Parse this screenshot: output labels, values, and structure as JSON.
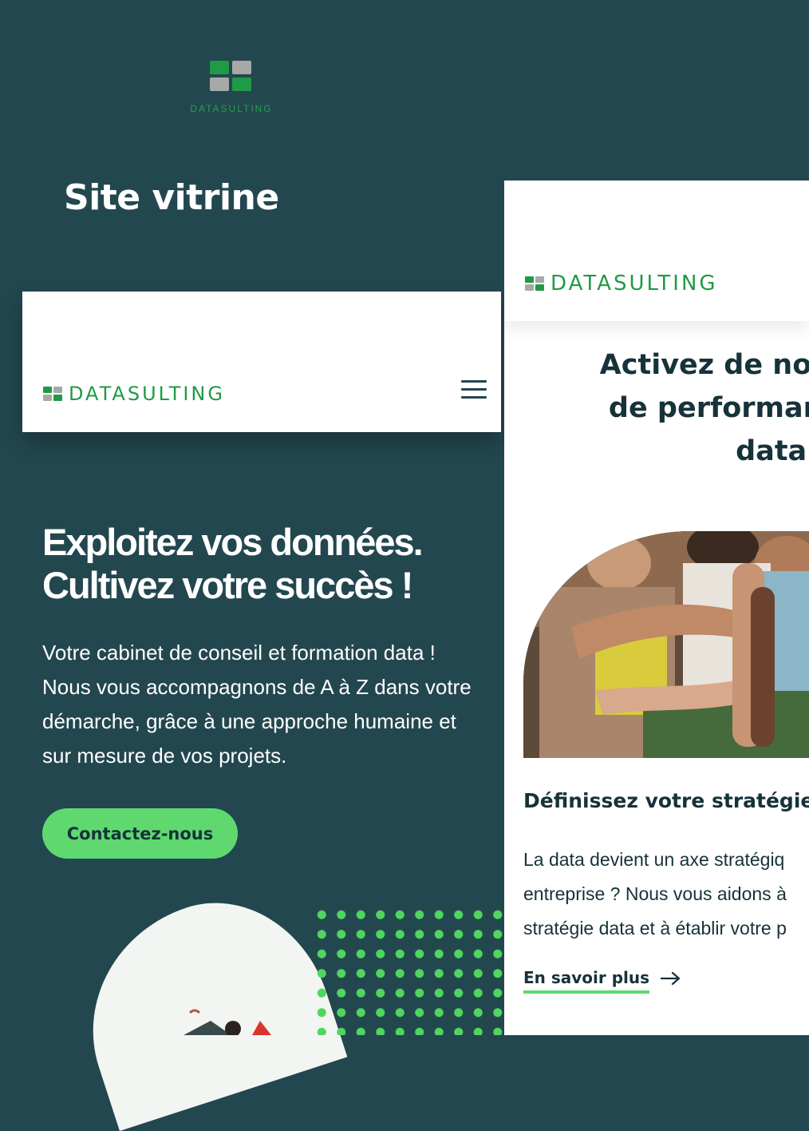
{
  "colors": {
    "background": "#23474f",
    "brand_green": "#1f9a46",
    "accent_green": "#5fd96f",
    "dark_text": "#16323a",
    "logo_grey": "#a8a8a8"
  },
  "top_logo": {
    "wordmark": "DATASULTING"
  },
  "section_title": "Site vitrine",
  "left_mockup": {
    "header": {
      "brand": "DATASULTING",
      "menu_icon": "hamburger-icon"
    },
    "hero": {
      "title": "Exploitez vos données. Cultivez votre succès !",
      "text": "Votre cabinet de conseil et formation data ! Nous vous accompagnons de A à Z dans votre démarche, grâce à une approche humaine et sur mesure de vos projets.",
      "cta": "Contactez-nous"
    }
  },
  "right_mockup": {
    "header": {
      "brand": "DATASULTING"
    },
    "title": "Activez de nouvea\n de performance g\n        data !",
    "subtitle": "Définissez votre stratégie D",
    "text": "La data devient un axe stratégiq\nentreprise ? Nous vous aidons à\nstratégie data et à établir votre p",
    "link": "En savoir plus",
    "link_icon": "arrow-right-icon"
  }
}
